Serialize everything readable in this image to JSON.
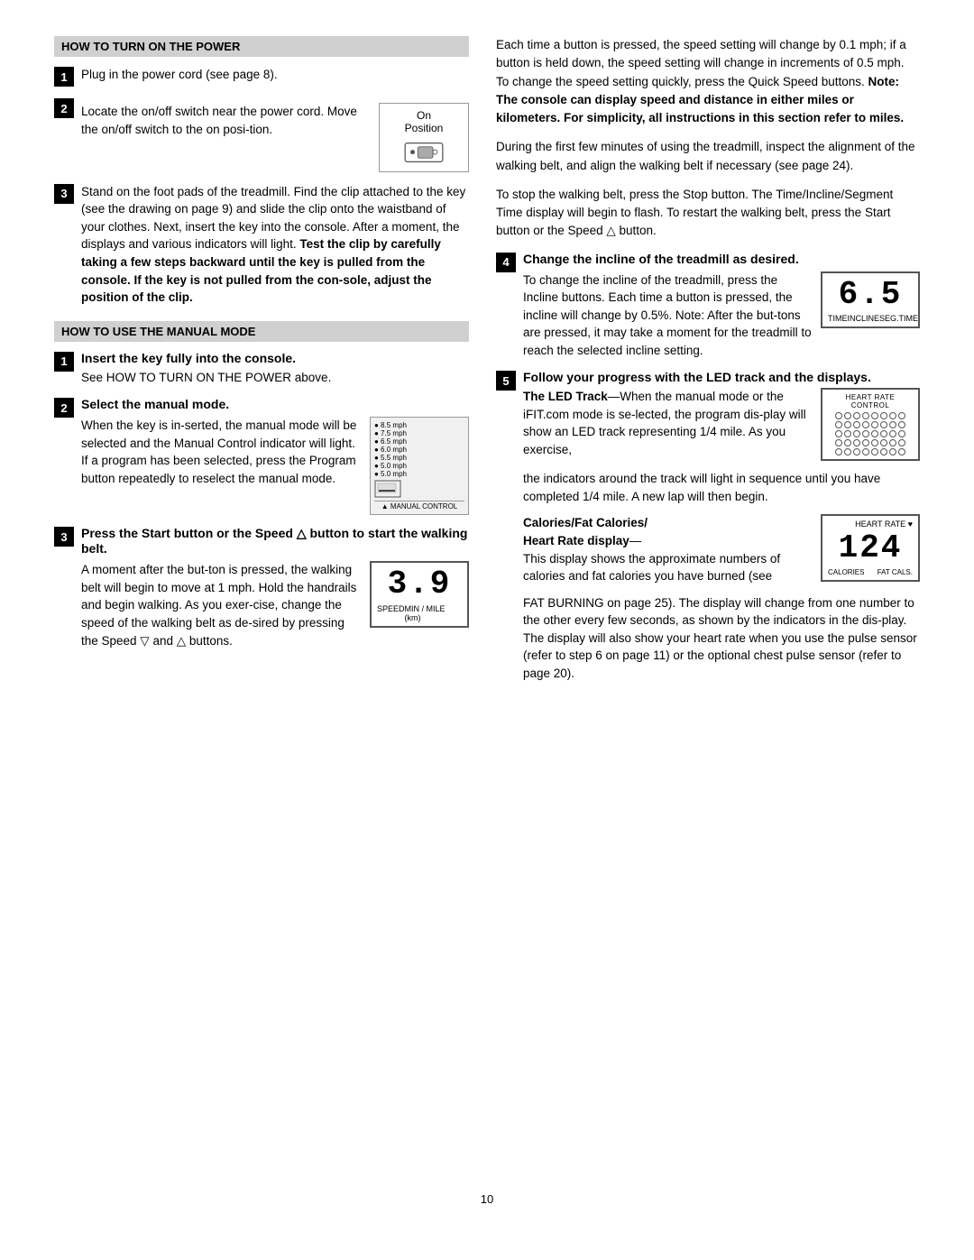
{
  "left_col": {
    "section1": {
      "header": "HOW TO TURN ON THE POWER",
      "steps": [
        {
          "num": "1",
          "text": "Plug in the power cord (see page 8)."
        },
        {
          "num": "2",
          "title": null,
          "text_before": "Locate the on/off switch near the power cord. Move the on/off switch to the on posi-tion.",
          "diagram_label": "On\nPosition"
        },
        {
          "num": "3",
          "text": "Stand on the foot pads of the treadmill. Find the clip attached to the key (see the drawing on page 9) and slide the clip onto the waistband of your clothes. Next, insert the key into the console. After a moment, the displays and various indicators will light.",
          "bold_text": "Test the clip by carefully taking a few steps backward until the key is pulled from the console. If the key is not pulled from the con-sole, adjust the position of the clip."
        }
      ]
    },
    "section2": {
      "header": "HOW TO USE THE MANUAL MODE",
      "steps": [
        {
          "num": "1",
          "title": "Insert the key fully into the console.",
          "text": "See HOW TO TURN ON THE POWER above."
        },
        {
          "num": "2",
          "title": "Select the manual mode.",
          "text": "When the key is in-serted, the manual mode will be selected and the Manual Control indicator will light. If a program has been selected, press the Program button repeatedly to reselect the manual mode.",
          "diagram_label": "MANUAL CONTROL"
        },
        {
          "num": "3",
          "title": "Press the Start button or the Speed △ button to start the walking belt.",
          "text": "A moment after the but-ton is pressed, the walking belt will begin to move at 1 mph. Hold the handrails and begin walking. As you exer-cise, change the speed of the walking belt as de-sired by pressing the Speed ▽ and △ buttons.",
          "diagram_speed": "3.9",
          "diagram_speed_labels": [
            "SPEED",
            "MIN / MILE (km)"
          ]
        }
      ]
    }
  },
  "right_col": {
    "para1": "Each time a button is pressed, the speed setting will change by 0.1 mph; if a button is held down, the speed setting will change in increments of 0.5 mph. To change the speed setting quickly, press the Quick Speed buttons.",
    "para1_bold": "Note: The console can display speed and distance in either miles or kilometers. For simplicity, all instructions in this section refer to miles.",
    "para2": "During the first few minutes of using the treadmill, inspect the alignment of the walking belt, and align the walking belt if necessary (see page 24).",
    "para3": "To stop the walking belt, press the Stop button. The Time/Incline/Segment Time display will begin to flash. To restart the walking belt, press the Start button or the Speed △ button.",
    "step4": {
      "num": "4",
      "title": "Change the incline of the treadmill as desired.",
      "text": "To change the incline of the treadmill, press the Incline buttons. Each time a button is pressed, the incline will change by 0.5%. Note: After the but-tons are pressed, it may take a moment for the treadmill to reach the selected incline setting.",
      "diagram_num": "6.5",
      "diagram_labels": [
        "TIME",
        "INCLINE",
        "SEG.TIME"
      ]
    },
    "step5": {
      "num": "5",
      "title": "Follow your progress with the LED track and the displays.",
      "led_title": "The LED Track",
      "led_dash": "—",
      "led_text": "When the manual mode or the iFIT.com mode is se-lected, the program dis-play will show an LED track representing 1/4 mile. As you exercise, the indicators around the track will light in sequence until you have completed 1/4 mile. A new lap will then begin.",
      "led_header": "HEART RATE  CONTROL",
      "cal_title": "Calories/Fat Calories/",
      "cal_title2": "Heart Rate display",
      "cal_dash": "—",
      "cal_text": "This display shows the approximate numbers of calories and fat calories you have burned (see FAT BURNING on page 25). The display will also show your heart rate when you use the pulse sensor (refer to step 6 on page 11) or the optional chest pulse sensor (refer to page 20).",
      "cal_num": "124",
      "cal_header": "HEART RATE ♥",
      "cal_labels": [
        "CALORIES",
        "FAT CALS."
      ]
    }
  },
  "page_number": "10"
}
